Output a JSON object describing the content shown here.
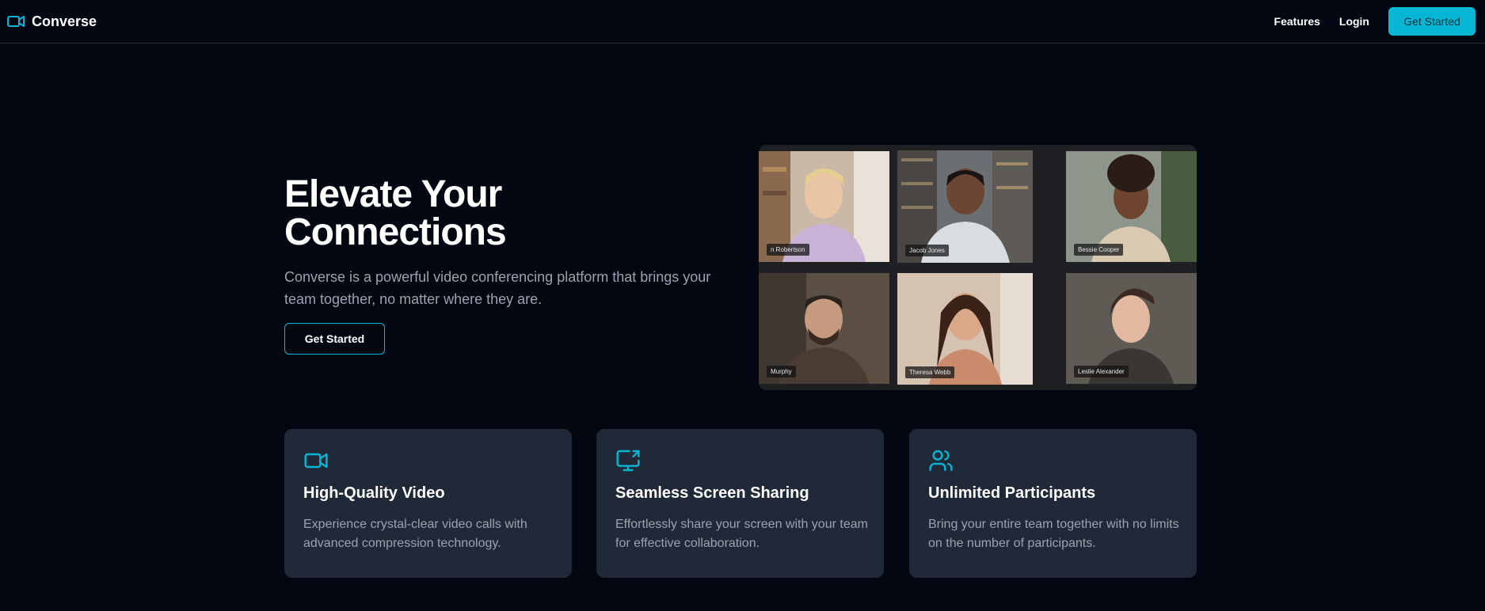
{
  "header": {
    "brand": "Converse",
    "nav": [
      "Features",
      "Login"
    ],
    "cta": "Get Started"
  },
  "hero": {
    "title_line1": "Elevate Your",
    "title_line2": "Connections",
    "subtitle": "Converse is a powerful video conferencing platform that brings your team together, no matter where they are.",
    "cta": "Get Started"
  },
  "video_grid": {
    "participants": [
      "n Robertson",
      "Jacob Jones",
      "Bessie Cooper",
      "Murphy",
      "Theresa Webb",
      "Leslie Alexander"
    ]
  },
  "features": [
    {
      "icon": "video-camera-icon",
      "title": "High-Quality Video",
      "description": "Experience crystal-clear video calls with advanced compression technology."
    },
    {
      "icon": "screen-share-icon",
      "title": "Seamless Screen Sharing",
      "description": "Effortlessly share your screen with your team for effective collaboration."
    },
    {
      "icon": "users-icon",
      "title": "Unlimited Participants",
      "description": "Bring your entire team together with no limits on the number of participants."
    }
  ],
  "colors": {
    "background": "#030712",
    "accent": "#06b6d4",
    "card": "#1f2937",
    "muted_text": "#9ca3af"
  }
}
